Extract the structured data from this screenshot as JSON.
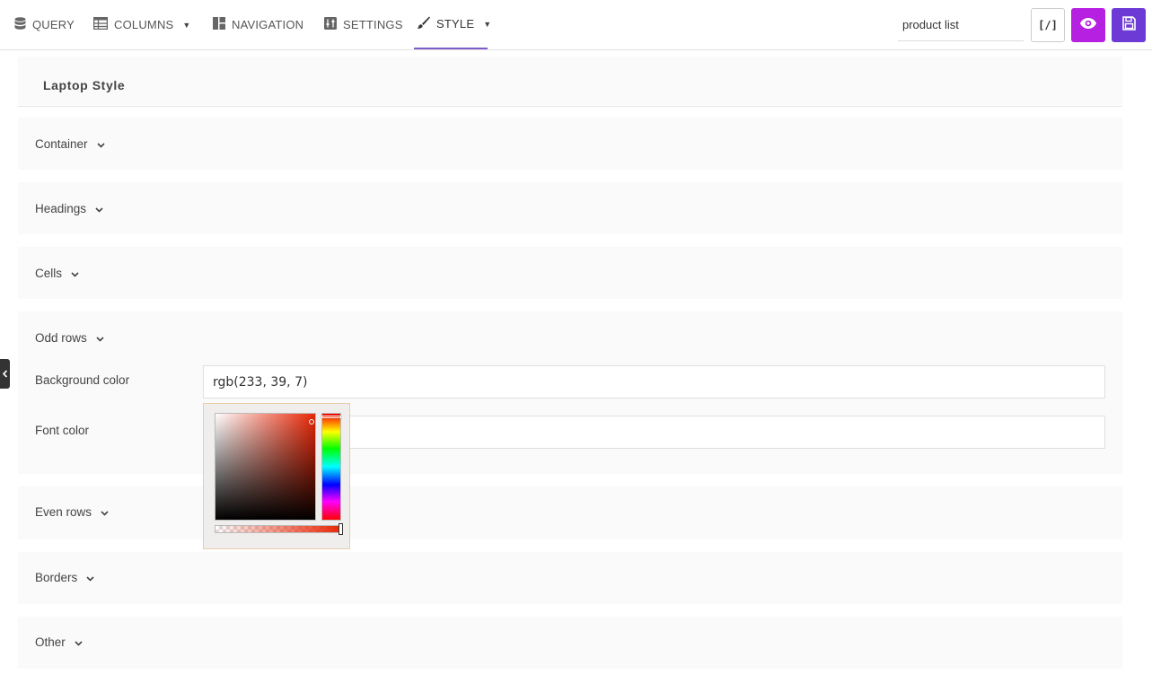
{
  "nav": {
    "tabs": [
      {
        "label": "QUERY",
        "icon": "database-icon"
      },
      {
        "label": "COLUMNS",
        "icon": "table-icon",
        "has_dropdown": true
      },
      {
        "label": "NAVIGATION",
        "icon": "grid-icon"
      },
      {
        "label": "SETTINGS",
        "icon": "settings-icon"
      },
      {
        "label": "STYLE",
        "icon": "brush-icon",
        "has_dropdown": true,
        "active": true
      }
    ],
    "search_value": "product list",
    "code_label": "[/]",
    "preview_icon": "eye-icon",
    "save_icon": "save-icon"
  },
  "panel": {
    "title": "Laptop Style"
  },
  "sections": [
    {
      "label": "Container"
    },
    {
      "label": "Headings"
    },
    {
      "label": "Cells"
    },
    {
      "label": "Odd rows",
      "expanded": true
    },
    {
      "label": "Even rows"
    },
    {
      "label": "Borders"
    },
    {
      "label": "Other"
    }
  ],
  "odd_rows": {
    "background_label": "Background color",
    "background_value": "rgb(233, 39, 7)",
    "font_label": "Font color",
    "font_value": ""
  },
  "colors": {
    "accent": "#7b5cc9",
    "preview_button": "#b620e0",
    "save_button": "#6d3ad6",
    "picked": "rgb(233, 39, 7)"
  }
}
